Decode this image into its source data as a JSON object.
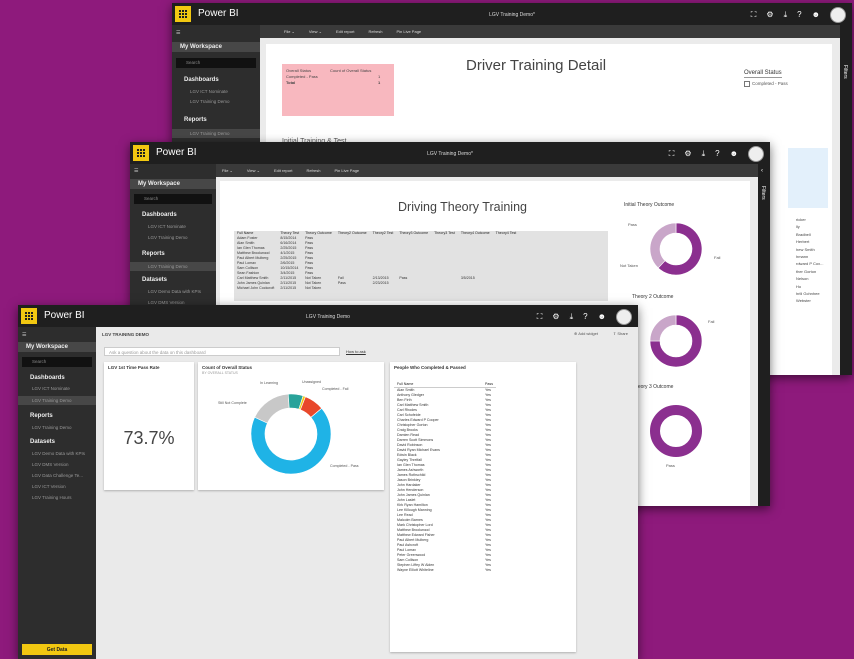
{
  "colors": {
    "background": "#8e1a7c",
    "accent": "#f2c811",
    "topbar": "#1f1f1f",
    "donut_purple": "#8b2f8f",
    "donut_light": "#c9a6c9",
    "donut_blue": "#1fb3e6",
    "donut_gray": "#c8c8c8",
    "donut_red": "#e8482b",
    "donut_teal": "#29a39a",
    "driver_highlight": "#f8b8bf"
  },
  "icons": [
    "waffle-icon",
    "fullscreen-icon",
    "gear-icon",
    "download-icon",
    "help-icon",
    "smiley-icon",
    "search-icon",
    "dashboard-icon",
    "report-icon",
    "dataset-icon",
    "warning-icon",
    "chevron-left-icon",
    "star-icon",
    "share-icon"
  ],
  "app": {
    "name": "Power BI"
  },
  "sidebar": {
    "my_workspace": "My Workspace",
    "search": "Search",
    "dashboards": "Dashboards",
    "dashboard_items": [
      "LGV ICT Nominate",
      "LGV Training Demo"
    ],
    "reports": "Reports",
    "report_items": [
      "LGV Training Demo"
    ],
    "datasets": "Datasets",
    "dataset_items": [
      "LGV Demo Data with KPIs",
      "LGV DMS Version",
      "LGV Data Challenge Te...",
      "LGV ICT Version",
      "LGV Training Hours"
    ],
    "get_data": "Get Data"
  },
  "toolbar": {
    "file": "File ⌄",
    "view": "View ⌄",
    "edit_report": "Edit report",
    "refresh": "Refresh",
    "pin_live_page": "Pin Live Page"
  },
  "filters_label": "Filters",
  "window_back": {
    "doc_title": "LGV Training Demo*",
    "page_title": "Driver Training Detail",
    "summary_headers": [
      "Overall Status",
      "Count of Overall Status"
    ],
    "summary_rows": [
      [
        "Completed - Pass",
        "1"
      ],
      [
        "Total",
        "1"
      ]
    ],
    "overall_status_title": "Overall Status",
    "overall_status_option": "Completed - Pass",
    "section_label": "Initial Training & Test",
    "right_names": [
      "ricker",
      "lly",
      "Bradbell",
      "Herbert",
      "hew Smith",
      "hmann",
      "rdward P Cox...",
      "ther Gorton",
      "Nelson",
      "Ho",
      "hrili Gchnhee",
      "Webster"
    ]
  },
  "window_mid": {
    "doc_title": "LGV Training Demo*",
    "page_title": "Driving Theory Training",
    "table_headers": [
      "Full Name",
      "Theory Test",
      "Theory Outcome",
      "Theory2 Outcome",
      "Theory2 Test",
      "Theory3 Outcome",
      "Theory3 Test",
      "Theory4 Outcome",
      "Theory4 Test"
    ],
    "table_rows": [
      [
        "Adam Foster",
        "8/15/2014",
        "Pass",
        "",
        "",
        "",
        "",
        "",
        ""
      ],
      [
        "Alan Smith",
        "6/16/2014",
        "Pass",
        "",
        "",
        "",
        "",
        "",
        ""
      ],
      [
        "Ian Glen Thomas",
        "2/25/2015",
        "Pass",
        "",
        "",
        "",
        "",
        "",
        ""
      ],
      [
        "Matthew Brookwood",
        "4/1/2015",
        "Pass",
        "",
        "",
        "",
        "",
        "",
        ""
      ],
      [
        "Paul Albert Mulberg",
        "2/25/2015",
        "Pass",
        "",
        "",
        "",
        "",
        "",
        ""
      ],
      [
        "Paul Lomax",
        "2/6/2015",
        "Pass",
        "",
        "",
        "",
        "",
        "",
        ""
      ],
      [
        "Sam Collison",
        "10/15/2014",
        "Pass",
        "",
        "",
        "",
        "",
        "",
        ""
      ],
      [
        "Sean Fashion",
        "3/4/2015",
        "Pass",
        "",
        "",
        "",
        "",
        "",
        ""
      ],
      [
        "Carl Matthew Smith",
        "2/11/2015",
        "Not Taken",
        "Fail",
        "2/13/2015",
        "Pass",
        "",
        "3/5/2015",
        ""
      ],
      [
        "John James Quinlan",
        "2/11/2015",
        "Not Taken",
        "Pass",
        "2/23/2015",
        "",
        "",
        "",
        ""
      ],
      [
        "Michael John Cockcroft",
        "2/11/2015",
        "Not Taken",
        "",
        "",
        "",
        "",
        "",
        ""
      ]
    ],
    "outcome1_title": "Initial Theory Outcome",
    "outcome1_labels": [
      "Pass",
      "Fail",
      "Not Taken"
    ],
    "outcome2_title": "Theory 2 Outcome",
    "outcome2_labels": [
      "Fail"
    ],
    "outcome3_title": "Theory 3 Outcome",
    "outcome3_labels": [
      "Pass"
    ]
  },
  "window_front": {
    "doc_title": "LGV Training Demo",
    "dashboard_title": "LGV TRAINING DEMO",
    "add_widget": "Add widget",
    "share": "Share",
    "qa_placeholder": "Ask a question about the data on this dashboard",
    "how_to_ask": "How to ask",
    "kpi_title": "LGV 1st Time Pass Rate",
    "kpi_value": "73.7%",
    "donut_title": "Count of Overall Status",
    "donut_subtitle": "BY OVERALL STATUS",
    "donut_labels": [
      "In Learning",
      "Unassigned",
      "Completed - Fail",
      "Still Not Complete",
      "Completed - Pass"
    ],
    "people_title": "People Who Completed & Passed",
    "people_headers": [
      "Full Name",
      "Pass"
    ],
    "people": [
      "Alan Smith",
      "Anthony Gledger",
      "Ben Firth",
      "Carl Matthew Smith",
      "Carl Rhodes",
      "Carl Schofeide",
      "Charles Edward P Cooper",
      "Christopher Gorton",
      "Craig Brooks",
      "Damien Read",
      "Darren Scott Simmons",
      "David Robinson",
      "David Ryan Michael Evans",
      "Edwin Black",
      "Gayley Threlfall",
      "Ian Glen Thomas",
      "James Ashworth",
      "James Rothschild",
      "Jason Brinkley",
      "John Hardaker",
      "John Henderson",
      "John James Quinlan",
      "John Laslet",
      "Kirk Ryan Hamilton",
      "Lee Killough Manning",
      "Lee Read",
      "Malcolm Barnes",
      "Mark Christopher Lord",
      "Matthew Brookwood",
      "Matthew Edward Fisher",
      "Paul Albert Mulberg",
      "Paul Ashcroft",
      "Paul Lomax",
      "Peter Greenwood",
      "Sam Collison",
      "Stephen Liffey W Alden",
      "Wayne Elliott Whiteline"
    ],
    "pass_value": "Yes"
  },
  "chart_data": [
    {
      "type": "pie",
      "title": "Count of Overall Status",
      "categories": [
        "Completed - Pass",
        "Still Not Complete",
        "In Learning",
        "Unassigned",
        "Completed - Fail"
      ],
      "values": [
        68,
        17,
        6,
        1,
        8
      ]
    },
    {
      "type": "pie",
      "title": "Initial Theory Outcome",
      "categories": [
        "Pass",
        "Not Taken"
      ],
      "values": [
        62,
        38
      ]
    },
    {
      "type": "pie",
      "title": "Theory 2 Outcome",
      "categories": [
        "Fail",
        "Pass"
      ],
      "values": [
        75,
        25
      ]
    },
    {
      "type": "pie",
      "title": "Theory 3 Outcome",
      "categories": [
        "Pass"
      ],
      "values": [
        100
      ]
    }
  ]
}
